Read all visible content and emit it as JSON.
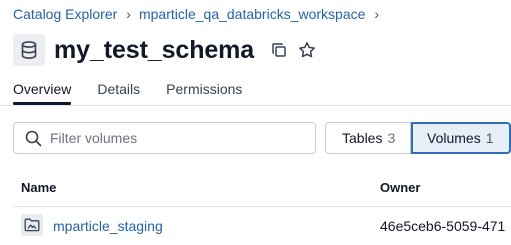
{
  "breadcrumb": {
    "items": [
      "Catalog Explorer",
      "mparticle_qa_databricks_workspace"
    ],
    "separator": "›"
  },
  "header": {
    "title": "my_test_schema",
    "icon": "database-icon",
    "actions": [
      "copy-icon",
      "star-icon"
    ]
  },
  "tabs": [
    {
      "label": "Overview",
      "active": true
    },
    {
      "label": "Details",
      "active": false
    },
    {
      "label": "Permissions",
      "active": false
    }
  ],
  "search": {
    "placeholder": "Filter volumes",
    "value": ""
  },
  "toggle": {
    "tables": {
      "label": "Tables",
      "count": "3",
      "selected": false
    },
    "volumes": {
      "label": "Volumes",
      "count": "1",
      "selected": true
    }
  },
  "table": {
    "columns": [
      "Name",
      "Owner"
    ],
    "rows": [
      {
        "name": "mparticle_staging",
        "owner": "46e5ceb6-5059-471",
        "icon": "volume-folder-icon"
      }
    ]
  },
  "colors": {
    "link": "#2563a8",
    "selected_border": "#2f6fb5",
    "selected_bg": "#e6eef8"
  }
}
